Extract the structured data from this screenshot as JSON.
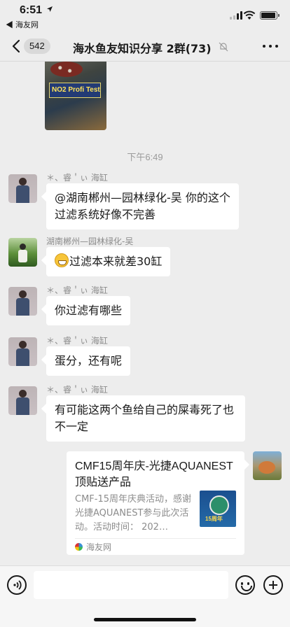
{
  "status_bar": {
    "time": "6:51",
    "back_app": "◀ 海友网"
  },
  "nav": {
    "back_count": "542",
    "title": "海水鱼友知识分享 2群(73)"
  },
  "chat": {
    "image_text": "NO2 Profi Test",
    "timestamp": "下午6:49",
    "messages": [
      {
        "sender": "＊、睿＇ぃ 海缸",
        "text": "@湖南郴州—园林绿化-吴 你的这个过滤系统好像不完善"
      },
      {
        "sender": "湖南郴州—园林绿化-吴",
        "text": "过滤本来就差30缸"
      },
      {
        "sender": "＊、睿＇ぃ 海缸",
        "text": "你过滤有哪些"
      },
      {
        "sender": "＊、睿＇ぃ 海缸",
        "text": "蛋分，还有呢"
      },
      {
        "sender": "＊、睿＇ぃ 海缸",
        "text": "有可能这两个鱼给自己的屎毒死了也不一定"
      }
    ],
    "link_card": {
      "title": "CMF15周年庆-光捷AQUANEST顶贴送产品",
      "description": "CMF-15周年庆典活动，感谢光捷AQUANEST参与此次活动。活动时间： 202…",
      "thumb_label": "15周年",
      "source": "海友网"
    }
  },
  "input_bar": {
    "placeholder": ""
  }
}
